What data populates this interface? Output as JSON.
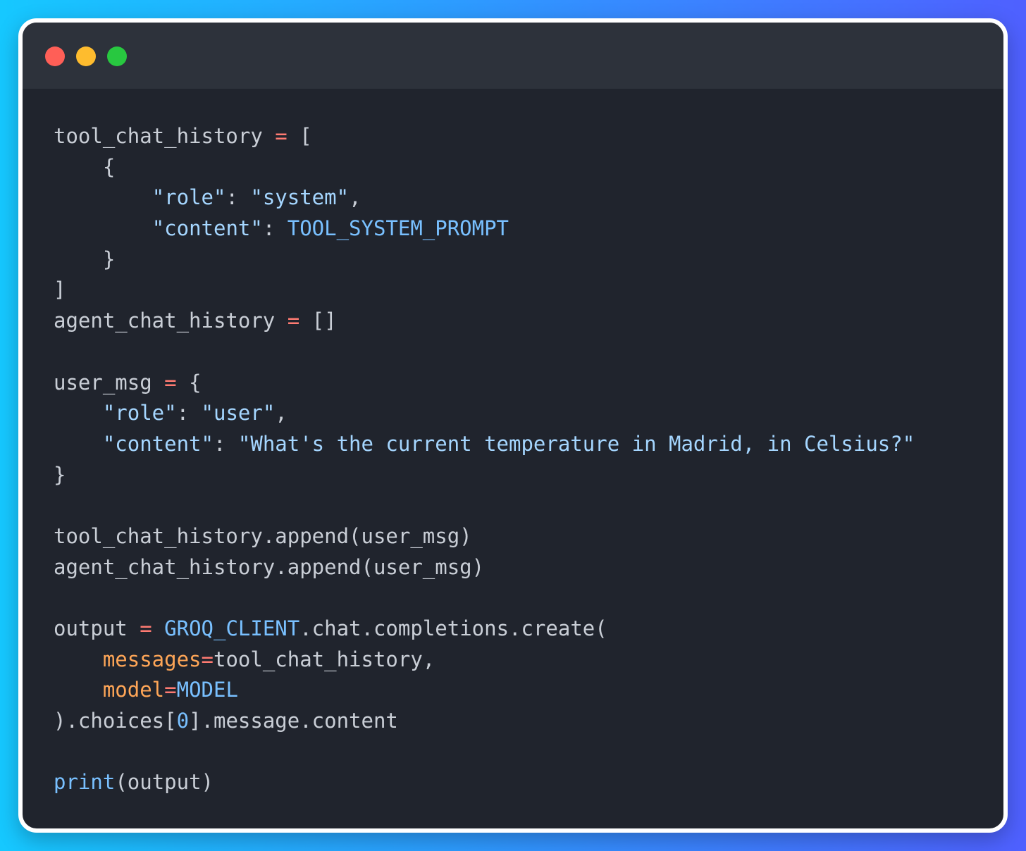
{
  "window": {
    "controls": [
      {
        "name": "close",
        "color": "#ff5f57"
      },
      {
        "name": "minimize",
        "color": "#febc2e"
      },
      {
        "name": "zoom",
        "color": "#28c840"
      }
    ]
  },
  "theme": {
    "background": "#20242d",
    "titlebar": "#2d323b",
    "plain": "#c9ced6",
    "operator": "#ff7b72",
    "string": "#a5d6ff",
    "constant": "#79c0ff",
    "parameter": "#ffa657"
  },
  "code": {
    "language": "python",
    "lines": [
      [
        {
          "t": "pl",
          "v": "tool_chat_history "
        },
        {
          "t": "op",
          "v": "="
        },
        {
          "t": "pl",
          "v": " ["
        }
      ],
      [
        {
          "t": "pl",
          "v": "    {"
        }
      ],
      [
        {
          "t": "pl",
          "v": "        "
        },
        {
          "t": "st",
          "v": "\"role\""
        },
        {
          "t": "pl",
          "v": ": "
        },
        {
          "t": "st",
          "v": "\"system\""
        },
        {
          "t": "pl",
          "v": ","
        }
      ],
      [
        {
          "t": "pl",
          "v": "        "
        },
        {
          "t": "st",
          "v": "\"content\""
        },
        {
          "t": "pl",
          "v": ": "
        },
        {
          "t": "cn",
          "v": "TOOL_SYSTEM_PROMPT"
        }
      ],
      [
        {
          "t": "pl",
          "v": "    }"
        }
      ],
      [
        {
          "t": "pl",
          "v": "]"
        }
      ],
      [
        {
          "t": "pl",
          "v": "agent_chat_history "
        },
        {
          "t": "op",
          "v": "="
        },
        {
          "t": "pl",
          "v": " []"
        }
      ],
      [],
      [
        {
          "t": "pl",
          "v": "user_msg "
        },
        {
          "t": "op",
          "v": "="
        },
        {
          "t": "pl",
          "v": " {"
        }
      ],
      [
        {
          "t": "pl",
          "v": "    "
        },
        {
          "t": "st",
          "v": "\"role\""
        },
        {
          "t": "pl",
          "v": ": "
        },
        {
          "t": "st",
          "v": "\"user\""
        },
        {
          "t": "pl",
          "v": ","
        }
      ],
      [
        {
          "t": "pl",
          "v": "    "
        },
        {
          "t": "st",
          "v": "\"content\""
        },
        {
          "t": "pl",
          "v": ": "
        },
        {
          "t": "st",
          "v": "\"What's the current temperature in Madrid, in Celsius?\""
        }
      ],
      [
        {
          "t": "pl",
          "v": "}"
        }
      ],
      [],
      [
        {
          "t": "pl",
          "v": "tool_chat_history.append(user_msg)"
        }
      ],
      [
        {
          "t": "pl",
          "v": "agent_chat_history.append(user_msg)"
        }
      ],
      [],
      [
        {
          "t": "pl",
          "v": "output "
        },
        {
          "t": "op",
          "v": "="
        },
        {
          "t": "pl",
          "v": " "
        },
        {
          "t": "cn",
          "v": "GROQ_CLIENT"
        },
        {
          "t": "pl",
          "v": ".chat.completions.create("
        }
      ],
      [
        {
          "t": "pl",
          "v": "    "
        },
        {
          "t": "pa",
          "v": "messages"
        },
        {
          "t": "op",
          "v": "="
        },
        {
          "t": "pl",
          "v": "tool_chat_history,"
        }
      ],
      [
        {
          "t": "pl",
          "v": "    "
        },
        {
          "t": "pa",
          "v": "model"
        },
        {
          "t": "op",
          "v": "="
        },
        {
          "t": "cn",
          "v": "MODEL"
        }
      ],
      [
        {
          "t": "pl",
          "v": ").choices["
        },
        {
          "t": "cn",
          "v": "0"
        },
        {
          "t": "pl",
          "v": "].message.content"
        }
      ],
      [],
      [
        {
          "t": "fn",
          "v": "print"
        },
        {
          "t": "pl",
          "v": "(output)"
        }
      ]
    ]
  }
}
